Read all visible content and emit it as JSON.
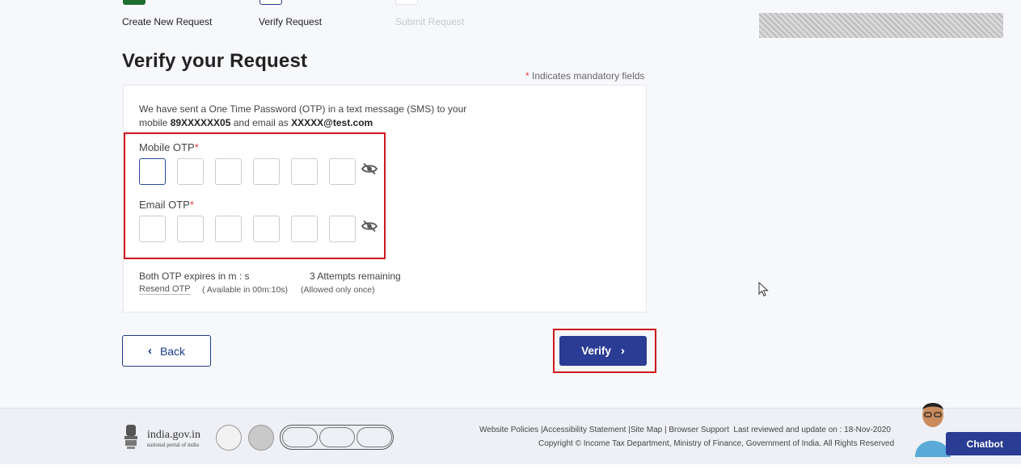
{
  "stepper": {
    "steps": [
      {
        "label": "Create New Request",
        "state": "done"
      },
      {
        "label": "Verify Request",
        "state": "active"
      },
      {
        "label": "Submit Request",
        "state": "disabled"
      }
    ]
  },
  "page": {
    "title": "Verify your Request",
    "mandatory_note": "Indicates mandatory fields",
    "mandatory_star": "*"
  },
  "message": {
    "line1": "We have sent a One Time Password (OTP) in a text message (SMS) to your",
    "prefix": "mobile ",
    "mobile": "89XXXXXX05",
    "middle": " and email as ",
    "email": "XXXXX@test.com"
  },
  "mobile_otp": {
    "label": "Mobile OTP",
    "star": "*",
    "digits": [
      "",
      "",
      "",
      "",
      "",
      ""
    ]
  },
  "email_otp": {
    "label": "Email OTP",
    "star": "*",
    "digits": [
      "",
      "",
      "",
      "",
      "",
      ""
    ]
  },
  "otp_status": {
    "expires": "Both OTP expires in m : s",
    "attempts": "3 Attempts remaining",
    "resend": "Resend OTP",
    "available": "( Available in 00m:10s)",
    "allowed": "(Allowed only once)"
  },
  "actions": {
    "back": "Back",
    "verify": "Verify"
  },
  "footer": {
    "portal_name": "india.gov.in",
    "portal_sub": "national portal of india",
    "links": "Website Policies |Accessibility Statement |Site Map | Browser Support",
    "reviewed": "Last reviewed and update on : 18-Nov-2020",
    "copyright": "Copyright © Income Tax Department, Ministry of Finance, Government of India. All Rights Reserved",
    "chatbot": "Chatbot"
  },
  "colors": {
    "primary": "#2a3c93",
    "done_step": "#1f6e2e",
    "highlight": "#d0161c",
    "mandatory": "#e23b3b"
  }
}
